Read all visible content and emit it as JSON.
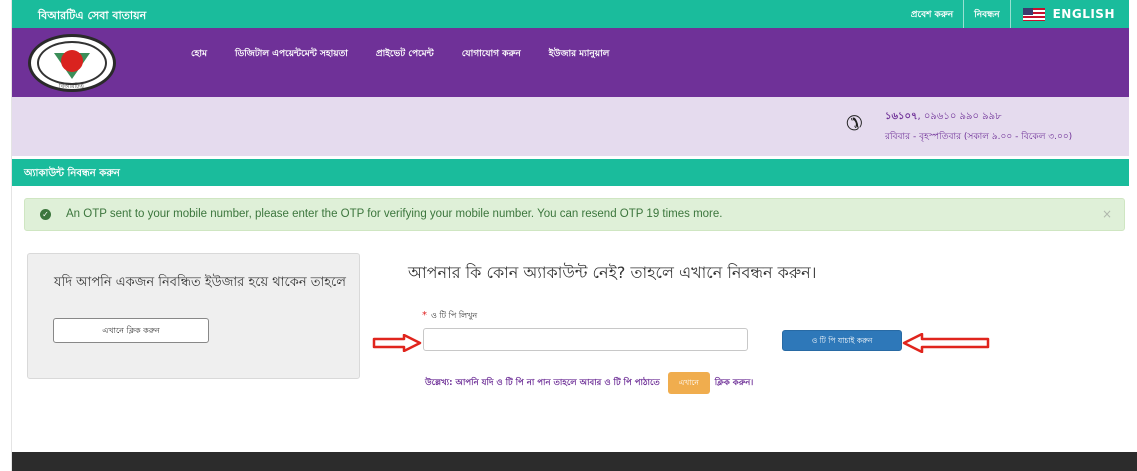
{
  "header": {
    "brand_title": "বিআরটিএ সেবা বাতায়ন",
    "links": {
      "login": "প্রবেশ করুন",
      "register": "নিবন্ধন",
      "language": "ENGLISH"
    }
  },
  "nav": {
    "logo_text": "বিআরটিএ",
    "items": [
      "হোম",
      "ডিজিটাল এপয়েন্টমেন্ট সহায়তা",
      "প্রাইভেট পেমেন্ট",
      "যোগাযোগ করুন",
      "ইউজার ম্যানুয়াল"
    ]
  },
  "contact": {
    "hotline_bold": "১৬১০৭",
    "hotline_rest": ", ০৯৬১০ ৯৯০ ৯৯৮",
    "hours": "রবিবার - বৃহস্পতিবার (সকাল ৯.০০ - বিকেল ৩.০০)"
  },
  "section": {
    "title": "অ্যাকাউন্ট নিবন্ধন করুন"
  },
  "alert": {
    "text": "An OTP sent to your mobile number, please enter the OTP for verifying your mobile number. You can resend OTP 19 times more.",
    "close": "×"
  },
  "login_box": {
    "text": "যদি আপনি একজন নিবন্ধিত ইউজার হয়ে থাকেন তাহলে",
    "button": "এখানে ক্লিক করুন"
  },
  "registration": {
    "heading": "আপনার কি কোন অ্যাকাউন্ট নেই? তাহলে এখানে নিবন্ধন করুন।",
    "otp_required": "*",
    "otp_label": "ও টি পি লিখুন",
    "otp_value": "",
    "verify_button": "ও টি পি যাচাই করুন",
    "resend_note": "উল্লেখ্য: আপনি যদি ও টি পি না পান তাহলে আবার ও টি পি পাঠাতে",
    "resend_button": "এখানে",
    "resend_suffix": "ক্লিক করুন।"
  },
  "colors": {
    "teal": "#1abc9c",
    "purple": "#6f3198",
    "lavender": "#e5dbee",
    "alert_green": "#3c763d",
    "verify_blue": "#2e78b9",
    "resend_orange": "#f0ad4e",
    "arrow_red": "#e0251d"
  }
}
